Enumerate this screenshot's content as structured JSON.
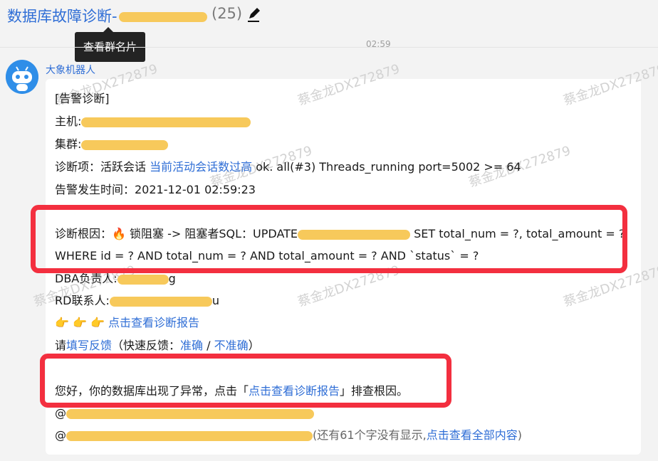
{
  "header": {
    "title": "数据库故障诊断-",
    "member_count": "(25)",
    "tooltip": "查看群名片",
    "time": "02:59"
  },
  "message": {
    "sender": "大象机器人",
    "watermarks": [
      "蔡金龙DX272879",
      "蔡金龙DX272879",
      "蔡金龙DX272879",
      "蔡金龙DX272879",
      "蔡金龙DX272879",
      "蔡金龙DX272879",
      "蔡金龙DX272879",
      "蔡金龙DX272879"
    ],
    "alarm_title": "[告警诊断]",
    "host_label": "主机:",
    "cluster_label": "集群:",
    "diagnosis_item_label": "诊断项：活跃会话 ",
    "diagnosis_item_link": "当前活动会话数过高",
    "diagnosis_item_text": " ok. all(#3) Threads_running port=5002 >= 64",
    "alarm_time": "告警发生时间：2021-12-01 02:59:23",
    "root_cause_prefix": "诊断根因：",
    "fire_icon": "🔥",
    "root_cause_part1": " 锁阻塞 -> 阻塞者SQL：UPDATE",
    "root_cause_part2": " SET total_num = ?, total_amount = ?",
    "root_cause_line2": "WHERE id = ? AND total_num = ? AND total_amount = ? AND `status` = ?",
    "dba_label": "DBA负责人:",
    "dba_suffix": "g",
    "rd_label": "RD联系人:",
    "rd_suffix": "u",
    "hand_icons": "👉 👉 👉 ",
    "report_link": "点击查看诊断报告",
    "feedback_prefix": "请",
    "feedback_link": "填写反馈",
    "feedback_middle": "（快速反馈：",
    "feedback_accurate": "准确",
    "feedback_separator": " / ",
    "feedback_inaccurate": "不准确",
    "feedback_end": "）",
    "notice_prefix": "您好，你的数据库出现了异常，点击「",
    "notice_link": "点击查看诊断报告",
    "notice_suffix": "」排查根因。",
    "mention_prefix": "@",
    "more_mentions_prefix": "@",
    "hidden_count": "(还有61个字没有显示,",
    "show_all_link": "点击查看全部内容",
    "hidden_count_end": ")"
  }
}
